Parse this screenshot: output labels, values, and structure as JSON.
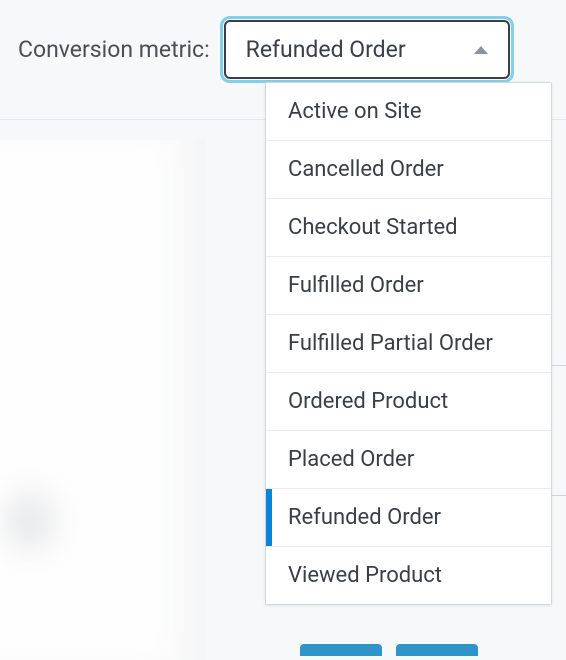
{
  "label": "Conversion metric:",
  "select": {
    "selected": "Refunded Order",
    "options": [
      "Active on Site",
      "Cancelled Order",
      "Checkout Started",
      "Fulfilled Order",
      "Fulfilled Partial Order",
      "Ordered Product",
      "Placed Order",
      "Refunded Order",
      "Viewed Product"
    ]
  }
}
